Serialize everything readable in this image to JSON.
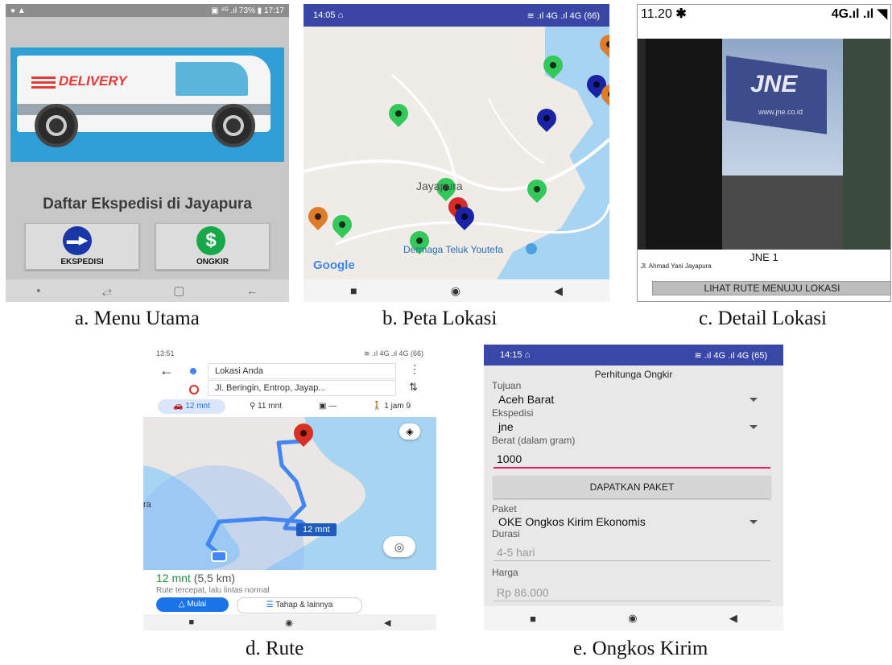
{
  "captions": {
    "a": "a. Menu Utama",
    "b": "b. Peta Lokasi",
    "c": "c. Detail Lokasi",
    "d": "d. Rute",
    "e": "e. Ongkos Kirim"
  },
  "panel_a": {
    "status_time": "17:17",
    "status_battery": "73%",
    "truck_text": "DELIVERY",
    "heading": "Daftar Ekspedisi di Jayapura",
    "btn_ekspedisi": "EKSPEDISI",
    "btn_ongkir": "ONGKIR",
    "ongkir_symbol": "$"
  },
  "panel_b": {
    "status_time": "14:05",
    "status_network": "4G",
    "status_battery": "66",
    "map_city": "Jayapura",
    "map_place": "Dermaga Teluk Youtefa",
    "map_brand": "Google"
  },
  "panel_c": {
    "status_time": "11.20",
    "status_network": "4G",
    "photo_sign": "JNE",
    "photo_url": "www.jne.co.id",
    "location_name": "JNE 1",
    "location_address": "Jl. Ahmad Yani Jayapura",
    "route_button": "LIHAT RUTE MENUJU LOKASI"
  },
  "panel_d": {
    "status_time": "13:51",
    "status_battery": "66",
    "origin": "Lokasi Anda",
    "destination": "Jl. Beringin, Entrop, Jayap...",
    "mode_car": "12 mnt",
    "mode_bike": "11 mnt",
    "mode_transit": "—",
    "mode_walk": "1 jam 9",
    "route_badge": "12 mnt",
    "map_label_left": "ra",
    "summary_time": "12 mnt",
    "summary_distance": "(5,5 km)",
    "summary_note": "Rute tercepat, lalu lintas normal",
    "btn_start": "Mulai",
    "btn_steps": "Tahap & lainnya"
  },
  "panel_e": {
    "status_time": "14:15",
    "status_battery": "65",
    "title": "Perhitunga Ongkir",
    "label_tujuan": "Tujuan",
    "val_tujuan": "Aceh Barat",
    "label_ekspedisi": "Ekspedisi",
    "val_ekspedisi": "jne",
    "label_berat": "Berat (dalam gram)",
    "val_berat": "1000",
    "btn_paket": "DAPATKAN PAKET",
    "label_paket": "Paket",
    "val_paket": "OKE Ongkos Kirim Ekonomis",
    "label_durasi": "Durasi",
    "val_durasi": "4-5 hari",
    "label_harga": "Harga",
    "val_harga": "Rp 86.000"
  },
  "colors": {
    "a_bg": "#c7c7c7",
    "a_sky": "#2f9fd6",
    "delivery_red": "#e53935",
    "b_status": "#3a46a5",
    "map_land": "#efebe7",
    "map_water": "#a7d4f2",
    "pin_green": "#34c759",
    "pin_blue": "#1a23a6",
    "pin_orange": "#e07b2a",
    "pin_red": "#d62b2b",
    "route_blue": "#4285f4",
    "maps_green": "#1e8e3e",
    "e_status": "#3947a8",
    "e_bg": "#e8e8e8",
    "input_underline": "#e91e63"
  }
}
